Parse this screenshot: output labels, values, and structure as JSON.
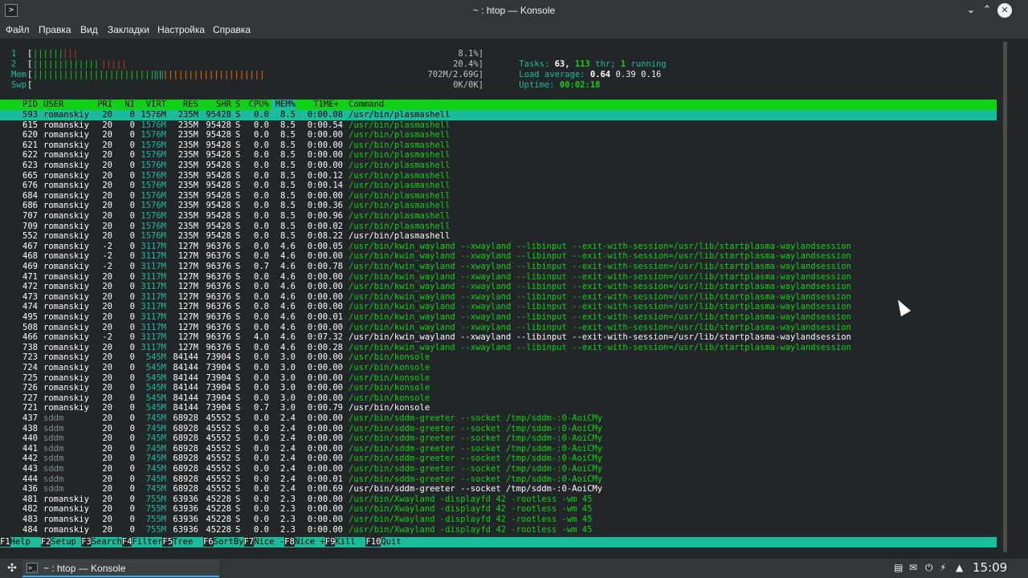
{
  "window": {
    "title": "~ : htop — Konsole",
    "app_icon": ">",
    "minimize_icon": "⌄",
    "maximize_icon": "⌃",
    "close_icon": "✕"
  },
  "menu": [
    "Файл",
    "Правка",
    "Вид",
    "Закладки",
    "Настройка",
    "Справка"
  ],
  "meters": {
    "cpu1": {
      "label": "1",
      "bars_green": "||||||",
      "bars_red": "|||",
      "pct": "8.1%]"
    },
    "cpu2": {
      "label": "2",
      "bars_green": "|||||||||||||",
      "bars_red": "|||||",
      "pct": "20.4%]"
    },
    "mem": {
      "label": "Mem",
      "bars_green": "||||||||||||||||||||||||||",
      "bars_blue": "||",
      "bars_orange": "||||||||||||||||||||",
      "value": "702M/2.69G]"
    },
    "swp": {
      "label": "Swp",
      "value": "0K/0K]"
    }
  },
  "summary": {
    "tasks_label": "Tasks:",
    "tasks": "63,",
    "threads": "113",
    "thr_label": "thr;",
    "running": "1",
    "running_label": "running",
    "load_label": "Load average:",
    "load1": "0.64",
    "load5": "0.39",
    "load15": "0.16",
    "uptime_label": "Uptime:",
    "uptime": "00:02:18"
  },
  "columns": [
    "PID",
    "USER",
    "PRI",
    "NI",
    "VIRT",
    "RES",
    "SHR",
    "S",
    "CPU%",
    "MEM%",
    "TIME+",
    "Command"
  ],
  "processes": [
    [
      "593",
      "romanskiy",
      "20",
      "0",
      "1576M",
      "235M",
      "95428",
      "S",
      "0.0",
      "8.5",
      "0:00.08",
      "/usr/bin/plasmashell"
    ],
    [
      "615",
      "romanskiy",
      "20",
      "0",
      "1576M",
      "235M",
      "95428",
      "S",
      "0.0",
      "8.5",
      "0:00.54",
      "/usr/bin/plasmashell"
    ],
    [
      "620",
      "romanskiy",
      "20",
      "0",
      "1576M",
      "235M",
      "95428",
      "S",
      "0.0",
      "8.5",
      "0:00.00",
      "/usr/bin/plasmashell"
    ],
    [
      "621",
      "romanskiy",
      "20",
      "0",
      "1576M",
      "235M",
      "95428",
      "S",
      "0.0",
      "8.5",
      "0:00.00",
      "/usr/bin/plasmashell"
    ],
    [
      "622",
      "romanskiy",
      "20",
      "0",
      "1576M",
      "235M",
      "95428",
      "S",
      "0.0",
      "8.5",
      "0:00.00",
      "/usr/bin/plasmashell"
    ],
    [
      "623",
      "romanskiy",
      "20",
      "0",
      "1576M",
      "235M",
      "95428",
      "S",
      "0.0",
      "8.5",
      "0:00.00",
      "/usr/bin/plasmashell"
    ],
    [
      "665",
      "romanskiy",
      "20",
      "0",
      "1576M",
      "235M",
      "95428",
      "S",
      "0.0",
      "8.5",
      "0:00.12",
      "/usr/bin/plasmashell"
    ],
    [
      "676",
      "romanskiy",
      "20",
      "0",
      "1576M",
      "235M",
      "95428",
      "S",
      "0.0",
      "8.5",
      "0:00.14",
      "/usr/bin/plasmashell"
    ],
    [
      "684",
      "romanskiy",
      "20",
      "0",
      "1576M",
      "235M",
      "95428",
      "S",
      "0.0",
      "8.5",
      "0:00.00",
      "/usr/bin/plasmashell"
    ],
    [
      "686",
      "romanskiy",
      "20",
      "0",
      "1576M",
      "235M",
      "95428",
      "S",
      "0.0",
      "8.5",
      "0:00.36",
      "/usr/bin/plasmashell"
    ],
    [
      "707",
      "romanskiy",
      "20",
      "0",
      "1576M",
      "235M",
      "95428",
      "S",
      "0.0",
      "8.5",
      "0:00.96",
      "/usr/bin/plasmashell"
    ],
    [
      "709",
      "romanskiy",
      "20",
      "0",
      "1576M",
      "235M",
      "95428",
      "S",
      "0.0",
      "8.5",
      "0:00.02",
      "/usr/bin/plasmashell"
    ],
    [
      "552",
      "romanskiy",
      "20",
      "0",
      "1576M",
      "235M",
      "95428",
      "S",
      "0.0",
      "8.5",
      "0:08.22",
      "/usr/bin/plasmashell"
    ],
    [
      "467",
      "romanskiy",
      "-2",
      "0",
      "3117M",
      "127M",
      "96376",
      "S",
      "0.0",
      "4.6",
      "0:00.05",
      "/usr/bin/kwin_wayland --xwayland --libinput --exit-with-session=/usr/lib/startplasma-waylandsession"
    ],
    [
      "468",
      "romanskiy",
      "-2",
      "0",
      "3117M",
      "127M",
      "96376",
      "S",
      "0.0",
      "4.6",
      "0:00.00",
      "/usr/bin/kwin_wayland --xwayland --libinput --exit-with-session=/usr/lib/startplasma-waylandsession"
    ],
    [
      "469",
      "romanskiy",
      "-2",
      "0",
      "3117M",
      "127M",
      "96376",
      "S",
      "0.7",
      "4.6",
      "0:00.78",
      "/usr/bin/kwin_wayland --xwayland --libinput --exit-with-session=/usr/lib/startplasma-waylandsession"
    ],
    [
      "471",
      "romanskiy",
      "20",
      "0",
      "3117M",
      "127M",
      "96376",
      "S",
      "0.0",
      "4.6",
      "0:00.00",
      "/usr/bin/kwin_wayland --xwayland --libinput --exit-with-session=/usr/lib/startplasma-waylandsession"
    ],
    [
      "472",
      "romanskiy",
      "20",
      "0",
      "3117M",
      "127M",
      "96376",
      "S",
      "0.0",
      "4.6",
      "0:00.00",
      "/usr/bin/kwin_wayland --xwayland --libinput --exit-with-session=/usr/lib/startplasma-waylandsession"
    ],
    [
      "473",
      "romanskiy",
      "20",
      "0",
      "3117M",
      "127M",
      "96376",
      "S",
      "0.0",
      "4.6",
      "0:00.00",
      "/usr/bin/kwin_wayland --xwayland --libinput --exit-with-session=/usr/lib/startplasma-waylandsession"
    ],
    [
      "474",
      "romanskiy",
      "20",
      "0",
      "3117M",
      "127M",
      "96376",
      "S",
      "0.0",
      "4.6",
      "0:00.00",
      "/usr/bin/kwin_wayland --xwayland --libinput --exit-with-session=/usr/lib/startplasma-waylandsession"
    ],
    [
      "495",
      "romanskiy",
      "20",
      "0",
      "3117M",
      "127M",
      "96376",
      "S",
      "0.0",
      "4.6",
      "0:00.01",
      "/usr/bin/kwin_wayland --xwayland --libinput --exit-with-session=/usr/lib/startplasma-waylandsession"
    ],
    [
      "508",
      "romanskiy",
      "20",
      "0",
      "3117M",
      "127M",
      "96376",
      "S",
      "0.0",
      "4.6",
      "0:00.00",
      "/usr/bin/kwin_wayland --xwayland --libinput --exit-with-session=/usr/lib/startplasma-waylandsession"
    ],
    [
      "466",
      "romanskiy",
      "-2",
      "0",
      "3117M",
      "127M",
      "96376",
      "S",
      "4.0",
      "4.6",
      "0:07.32",
      "/usr/bin/kwin_wayland --xwayland --libinput --exit-with-session=/usr/lib/startplasma-waylandsession"
    ],
    [
      "738",
      "romanskiy",
      "20",
      "0",
      "3117M",
      "127M",
      "96376",
      "S",
      "0.0",
      "4.6",
      "0:00.28",
      "/usr/bin/kwin_wayland --xwayland --libinput --exit-with-session=/usr/lib/startplasma-waylandsession"
    ],
    [
      "723",
      "romanskiy",
      "20",
      "0",
      "545M",
      "84144",
      "73904",
      "S",
      "0.0",
      "3.0",
      "0:00.00",
      "/usr/bin/konsole"
    ],
    [
      "724",
      "romanskiy",
      "20",
      "0",
      "545M",
      "84144",
      "73904",
      "S",
      "0.0",
      "3.0",
      "0:00.00",
      "/usr/bin/konsole"
    ],
    [
      "725",
      "romanskiy",
      "20",
      "0",
      "545M",
      "84144",
      "73904",
      "S",
      "0.0",
      "3.0",
      "0:00.00",
      "/usr/bin/konsole"
    ],
    [
      "726",
      "romanskiy",
      "20",
      "0",
      "545M",
      "84144",
      "73904",
      "S",
      "0.0",
      "3.0",
      "0:00.00",
      "/usr/bin/konsole"
    ],
    [
      "727",
      "romanskiy",
      "20",
      "0",
      "545M",
      "84144",
      "73904",
      "S",
      "0.0",
      "3.0",
      "0:00.00",
      "/usr/bin/konsole"
    ],
    [
      "721",
      "romanskiy",
      "20",
      "0",
      "545M",
      "84144",
      "73904",
      "S",
      "0.7",
      "3.0",
      "0:00.79",
      "/usr/bin/konsole"
    ],
    [
      "437",
      "sddm",
      "20",
      "0",
      "745M",
      "68928",
      "45552",
      "S",
      "0.0",
      "2.4",
      "0:00.00",
      "/usr/bin/sddm-greeter --socket /tmp/sddm-:0-AoiCMy"
    ],
    [
      "438",
      "sddm",
      "20",
      "0",
      "745M",
      "68928",
      "45552",
      "S",
      "0.0",
      "2.4",
      "0:00.00",
      "/usr/bin/sddm-greeter --socket /tmp/sddm-:0-AoiCMy"
    ],
    [
      "440",
      "sddm",
      "20",
      "0",
      "745M",
      "68928",
      "45552",
      "S",
      "0.0",
      "2.4",
      "0:00.00",
      "/usr/bin/sddm-greeter --socket /tmp/sddm-:0-AoiCMy"
    ],
    [
      "441",
      "sddm",
      "20",
      "0",
      "745M",
      "68928",
      "45552",
      "S",
      "0.0",
      "2.4",
      "0:00.00",
      "/usr/bin/sddm-greeter --socket /tmp/sddm-:0-AoiCMy"
    ],
    [
      "442",
      "sddm",
      "20",
      "0",
      "745M",
      "68928",
      "45552",
      "S",
      "0.0",
      "2.4",
      "0:00.00",
      "/usr/bin/sddm-greeter --socket /tmp/sddm-:0-AoiCMy"
    ],
    [
      "443",
      "sddm",
      "20",
      "0",
      "745M",
      "68928",
      "45552",
      "S",
      "0.0",
      "2.4",
      "0:00.00",
      "/usr/bin/sddm-greeter --socket /tmp/sddm-:0-AoiCMy"
    ],
    [
      "444",
      "sddm",
      "20",
      "0",
      "745M",
      "68928",
      "45552",
      "S",
      "0.0",
      "2.4",
      "0:00.01",
      "/usr/bin/sddm-greeter --socket /tmp/sddm-:0-AoiCMy"
    ],
    [
      "436",
      "sddm",
      "20",
      "0",
      "745M",
      "68928",
      "45552",
      "S",
      "0.0",
      "2.4",
      "0:00.69",
      "/usr/bin/sddm-greeter --socket /tmp/sddm-:0-AoiCMy"
    ],
    [
      "481",
      "romanskiy",
      "20",
      "0",
      "755M",
      "63936",
      "45228",
      "S",
      "0.0",
      "2.3",
      "0:00.00",
      "/usr/bin/Xwayland -displayfd 42 -rootless -wm 45"
    ],
    [
      "482",
      "romanskiy",
      "20",
      "0",
      "755M",
      "63936",
      "45228",
      "S",
      "0.0",
      "2.3",
      "0:00.00",
      "/usr/bin/Xwayland -displayfd 42 -rootless -wm 45"
    ],
    [
      "483",
      "romanskiy",
      "20",
      "0",
      "755M",
      "63936",
      "45228",
      "S",
      "0.0",
      "2.3",
      "0:00.00",
      "/usr/bin/Xwayland -displayfd 42 -rootless -wm 45"
    ],
    [
      "484",
      "romanskiy",
      "20",
      "0",
      "755M",
      "63936",
      "45228",
      "S",
      "0.0",
      "2.3",
      "0:00.00",
      "/usr/bin/Xwayland -displayfd 42 -rootless -wm 45"
    ]
  ],
  "main_process_pids": [
    "552",
    "466",
    "721",
    "436"
  ],
  "selected_pid": "593",
  "fkeys": [
    {
      "key": "F1",
      "label": "Help  "
    },
    {
      "key": "F2",
      "label": "Setup "
    },
    {
      "key": "F3",
      "label": "Search"
    },
    {
      "key": "F4",
      "label": "Filter"
    },
    {
      "key": "F5",
      "label": "Tree  "
    },
    {
      "key": "F6",
      "label": "SortBy"
    },
    {
      "key": "F7",
      "label": "Nice -"
    },
    {
      "key": "F8",
      "label": "Nice +"
    },
    {
      "key": "F9",
      "label": "Kill  "
    },
    {
      "key": "F10",
      "label": "Quit  "
    }
  ],
  "taskbar": {
    "launcher_icon": "✣",
    "task_icon": ">_",
    "task_label": "~ : htop — Konsole",
    "tray_icons": [
      "▤",
      "✉",
      "⏻",
      "⚡",
      "▲",
      "🔊"
    ],
    "clock": "15:09"
  },
  "colors": {
    "accent": "#3daee9",
    "header_green": "#11d116",
    "selection_teal": "#1abc9c"
  }
}
